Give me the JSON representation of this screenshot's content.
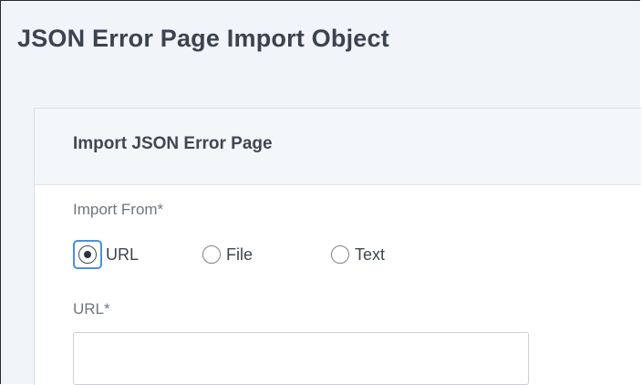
{
  "page": {
    "title": "JSON Error Page Import Object"
  },
  "panel": {
    "title": "Import JSON Error Page"
  },
  "form": {
    "import_from_label": "Import From*",
    "import_options": [
      {
        "label": "URL",
        "selected": true
      },
      {
        "label": "File",
        "selected": false
      },
      {
        "label": "Text",
        "selected": false
      }
    ],
    "url_label": "URL*",
    "url_value": "",
    "url_placeholder": ""
  },
  "colors": {
    "background": "#f1f5f9",
    "panel_header": "#f4f7fa",
    "focus_ring": "#4a90d9",
    "title_text": "#3b4350"
  }
}
